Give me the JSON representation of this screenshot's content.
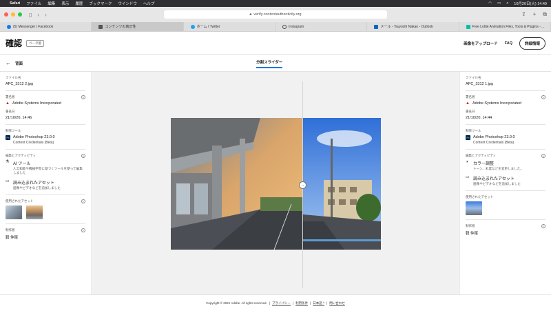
{
  "menubar": {
    "app": "Safari",
    "items": [
      "ファイル",
      "編集",
      "表示",
      "履歴",
      "ブックマーク",
      "ウインドウ",
      "ヘルプ"
    ],
    "clock": "10月20日(火) 14:49"
  },
  "browser": {
    "url": "verify.contentauthenticity.org",
    "tabs": [
      {
        "label": "(5) Messenger | Facebook",
        "color": "#1877f2"
      },
      {
        "label": "コンテンツの真正性",
        "color": "#555555"
      },
      {
        "label": "ホーム / Twitter",
        "color": "#1da1f2"
      },
      {
        "label": "Instagram",
        "color": "#444444"
      },
      {
        "label": "メール - Tsuyoshi Nakao - Outlook",
        "color": "#0a66c2"
      },
      {
        "label": "Free Lottie Animation Files, Tools & Plugins - ...",
        "color": "#00c1a2"
      }
    ]
  },
  "header": {
    "title": "確認",
    "badge": "ベータ版",
    "upload": "画像をアップロード",
    "faq": "FAQ",
    "details": "詳細情報"
  },
  "subheader": {
    "back": "背面",
    "mode": "分割スライダー"
  },
  "left_panel": {
    "file_label": "ファイル名",
    "file_name": "APC_3312 2.jpg",
    "signer_label": "署名者",
    "signer": "Adobe Systems Incorporated",
    "signed_date_label": "署名日",
    "signed_date": "21/10/20, 14:46",
    "tool_label": "制作ツール",
    "tool": "Adobe Photoshop 23.0.0",
    "tool_sub": "Content Credentials (Beta)",
    "activity_label": "編集とアクティビティ",
    "activities": [
      {
        "title": "AI ツール",
        "desc": "人工知能や機械学習に基づくツールを使って編集しました"
      },
      {
        "title": "読み込まれたアセット",
        "desc": "画像やビデオなどを追加しました"
      }
    ],
    "assets_label": "使用されたアセット",
    "producer_label": "制作者",
    "producer": "毅 仲尾"
  },
  "right_panel": {
    "file_label": "ファイル名",
    "file_name": "APC_3312 1.jpg",
    "signer_label": "署名者",
    "signer": "Adobe Systems Incorporated",
    "signed_date_label": "署名日",
    "signed_date": "21/10/20, 14:44",
    "tool_label": "制作ツール",
    "tool": "Adobe Photoshop 23.0.0",
    "tool_sub": "Content Credentials (Beta)",
    "activity_label": "編集とアクティビティ",
    "activities": [
      {
        "title": "カラー調整",
        "desc": "トーン、彩度などを変更しました。"
      },
      {
        "title": "読み込まれたアセット",
        "desc": "画像やビデオなどを追加しました"
      }
    ],
    "assets_label": "使用されたアセット",
    "producer_label": "制作者",
    "producer": "毅 仲尾"
  },
  "footer": {
    "copyright": "Copyright © 2021 Adobe. All rights reserved.",
    "privacy": "プライバシー",
    "terms": "利用条件",
    "language": "日本語 ^",
    "contact": "問い合わせ"
  },
  "icons": {
    "adobe": "adobe-logo-icon",
    "photoshop": "photoshop-icon",
    "ai": "ai-tool-icon",
    "folder": "folder-icon",
    "color": "color-adjust-icon",
    "help": "help-icon"
  }
}
